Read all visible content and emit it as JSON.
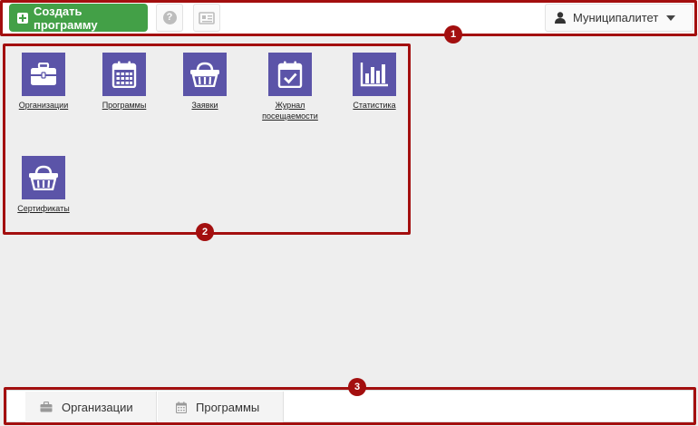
{
  "toolbar": {
    "create_label": "Создать программу",
    "help_glyph": "?",
    "user_label": "Муниципалитет"
  },
  "tiles": [
    {
      "label": "Организации",
      "icon": "briefcase-icon"
    },
    {
      "label": "Программы",
      "icon": "calendar-icon"
    },
    {
      "label": "Заявки",
      "icon": "basket-icon"
    },
    {
      "label": "Журнал\nпосещаемости",
      "icon": "calendar-check-icon"
    },
    {
      "label": "Статистика",
      "icon": "bar-chart-icon"
    },
    {
      "label": "Сертификаты",
      "icon": "basket-icon"
    }
  ],
  "bottom_tabs": [
    {
      "label": "Организации",
      "icon": "briefcase-icon"
    },
    {
      "label": "Программы",
      "icon": "calendar-icon"
    }
  ],
  "annotations": [
    "1",
    "2",
    "3"
  ],
  "colors": {
    "accent_green": "#43a047",
    "tile_purple": "#5b54a8",
    "annotation_red": "#a30f0f"
  }
}
